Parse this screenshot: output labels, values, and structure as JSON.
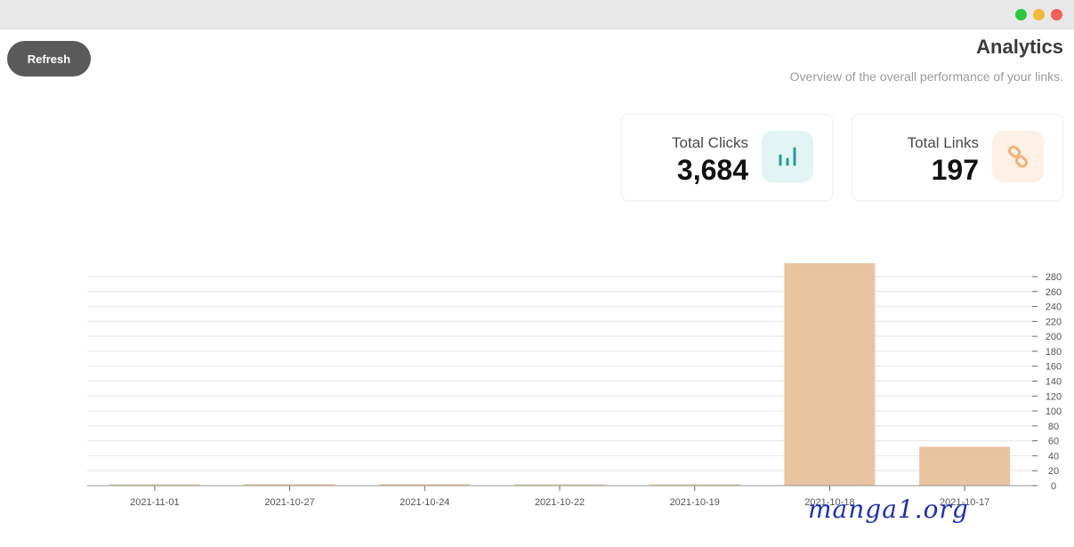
{
  "window": {
    "controls": [
      "close",
      "minimize",
      "maximize"
    ]
  },
  "header": {
    "title": "Analytics",
    "subtitle": "Overview of the overall performance of your links.",
    "refresh_label": "Refresh"
  },
  "stats": {
    "links": {
      "label": "Total Links",
      "value": "197",
      "icon": "link-icon",
      "color": "#f0b27a"
    },
    "clicks": {
      "label": "Total Clicks",
      "value": "3,684",
      "icon": "bar-chart-icon",
      "color": "#1f9e94"
    }
  },
  "chart_data": {
    "type": "bar",
    "categories": [
      "2021-10-17",
      "2021-10-18",
      "2021-10-19",
      "2021-10-22",
      "2021-10-24",
      "2021-10-27",
      "2021-11-01"
    ],
    "values": [
      52,
      298,
      1,
      1,
      2,
      2,
      1
    ],
    "yticks": [
      0,
      20,
      40,
      60,
      80,
      100,
      120,
      140,
      160,
      180,
      200,
      220,
      240,
      260,
      280
    ],
    "ylim": [
      0,
      280
    ],
    "grid": true,
    "bar_color": "#e8c4a0",
    "mirrored": true
  },
  "watermark": "manga1.org"
}
